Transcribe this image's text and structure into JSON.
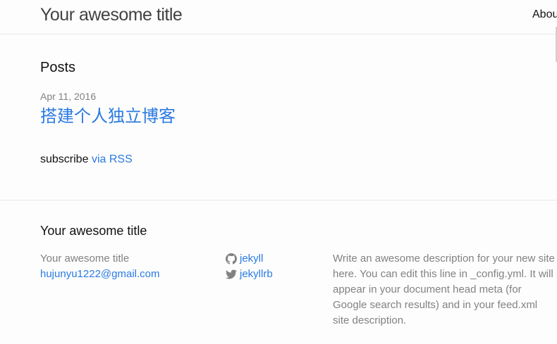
{
  "header": {
    "site_title": "Your awesome title",
    "nav": [
      "Abou"
    ]
  },
  "main": {
    "heading": "Posts",
    "posts": [
      {
        "date": "Apr 11, 2016",
        "title": "搭建个人独立博客"
      }
    ],
    "rss": {
      "prefix": "subscribe",
      "link_label": "via RSS"
    }
  },
  "footer": {
    "heading": "Your awesome title",
    "col1": {
      "name": "Your awesome title",
      "email": "hujunyu1222@gmail.com"
    },
    "social": [
      {
        "icon": "github-icon",
        "label": "jekyll"
      },
      {
        "icon": "twitter-icon",
        "label": "jekyllrb"
      }
    ],
    "description": "Write an awesome description for your new site here. You can edit this line in _config.yml. It will appear in your document head meta (for Google search results) and in your feed.xml site description."
  },
  "colors": {
    "link": "#2a7ae2",
    "meta_text": "#828282",
    "text": "#111111",
    "border": "#e8e8e8",
    "background": "#fdfdfd"
  }
}
